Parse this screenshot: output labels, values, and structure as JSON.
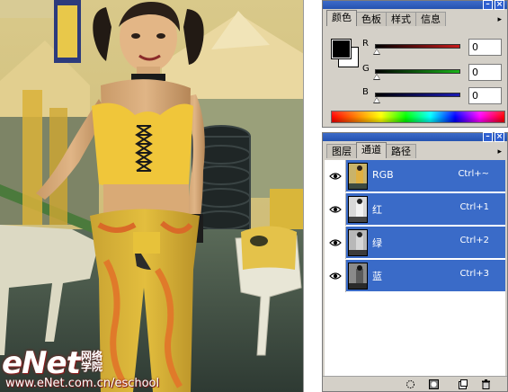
{
  "watermark": {
    "logo": "eNet",
    "cn_line1": "网络",
    "cn_line2": "学院",
    "url": "www.eNet.com.cn/eschool"
  },
  "color_panel": {
    "tabs": [
      {
        "label": "颜色",
        "active": true
      },
      {
        "label": "色板",
        "active": false
      },
      {
        "label": "样式",
        "active": false
      },
      {
        "label": "信息",
        "active": false
      }
    ],
    "foreground_color": "#000000",
    "background_color": "#ffffff",
    "sliders": [
      {
        "label": "R",
        "value": "0",
        "color": "#c81a1a"
      },
      {
        "label": "G",
        "value": "0",
        "color": "#1ab41a"
      },
      {
        "label": "B",
        "value": "0",
        "color": "#1a1ab4"
      }
    ]
  },
  "channels_panel": {
    "tabs": [
      {
        "label": "图层",
        "active": false
      },
      {
        "label": "通道",
        "active": true
      },
      {
        "label": "路径",
        "active": false
      }
    ],
    "channels": [
      {
        "name": "RGB",
        "shortcut": "Ctrl+~",
        "selected": true
      },
      {
        "name": "红",
        "shortcut": "Ctrl+1",
        "selected": true
      },
      {
        "name": "绿",
        "shortcut": "Ctrl+2",
        "selected": true
      },
      {
        "name": "蓝",
        "shortcut": "Ctrl+3",
        "selected": true
      }
    ],
    "bottom_icons": [
      "load-selection-icon",
      "save-selection-icon",
      "new-channel-icon",
      "delete-channel-icon"
    ]
  },
  "colors": {
    "panel_bg": "#d4d0c8",
    "selection": "#3a6bc8",
    "titlebar": "#2f5fc4"
  }
}
